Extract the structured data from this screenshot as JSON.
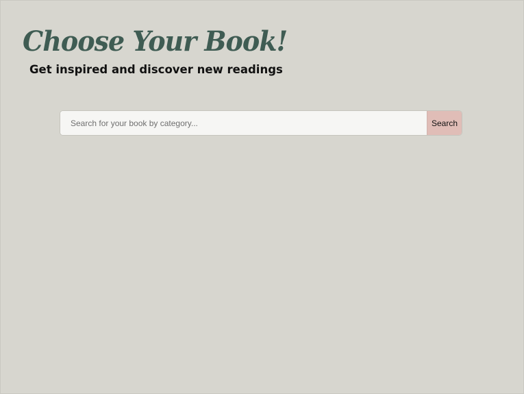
{
  "header": {
    "title": "Choose Your Book!",
    "subtitle": "Get inspired and discover new readings"
  },
  "search": {
    "placeholder": "Search for your book by category...",
    "value": "",
    "button_label": "Search"
  },
  "colors": {
    "background": "#d7d6cf",
    "title": "#3f5c53",
    "search_button": "#e0bdb7",
    "input_background": "#f6f6f4"
  }
}
